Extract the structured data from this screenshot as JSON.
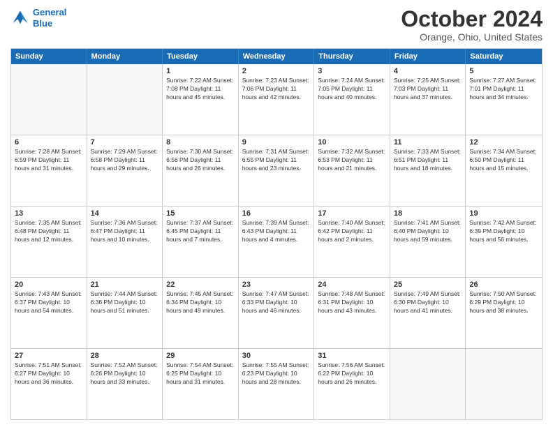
{
  "header": {
    "logo_line1": "General",
    "logo_line2": "Blue",
    "month_title": "October 2024",
    "location": "Orange, Ohio, United States"
  },
  "weekdays": [
    "Sunday",
    "Monday",
    "Tuesday",
    "Wednesday",
    "Thursday",
    "Friday",
    "Saturday"
  ],
  "rows": [
    [
      {
        "day": "",
        "info": "",
        "empty": true
      },
      {
        "day": "",
        "info": "",
        "empty": true
      },
      {
        "day": "1",
        "info": "Sunrise: 7:22 AM\nSunset: 7:08 PM\nDaylight: 11 hours and 45 minutes.",
        "empty": false
      },
      {
        "day": "2",
        "info": "Sunrise: 7:23 AM\nSunset: 7:06 PM\nDaylight: 11 hours and 42 minutes.",
        "empty": false
      },
      {
        "day": "3",
        "info": "Sunrise: 7:24 AM\nSunset: 7:05 PM\nDaylight: 11 hours and 40 minutes.",
        "empty": false
      },
      {
        "day": "4",
        "info": "Sunrise: 7:25 AM\nSunset: 7:03 PM\nDaylight: 11 hours and 37 minutes.",
        "empty": false
      },
      {
        "day": "5",
        "info": "Sunrise: 7:27 AM\nSunset: 7:01 PM\nDaylight: 11 hours and 34 minutes.",
        "empty": false
      }
    ],
    [
      {
        "day": "6",
        "info": "Sunrise: 7:28 AM\nSunset: 6:59 PM\nDaylight: 11 hours and 31 minutes.",
        "empty": false
      },
      {
        "day": "7",
        "info": "Sunrise: 7:29 AM\nSunset: 6:58 PM\nDaylight: 11 hours and 29 minutes.",
        "empty": false
      },
      {
        "day": "8",
        "info": "Sunrise: 7:30 AM\nSunset: 6:56 PM\nDaylight: 11 hours and 26 minutes.",
        "empty": false
      },
      {
        "day": "9",
        "info": "Sunrise: 7:31 AM\nSunset: 6:55 PM\nDaylight: 11 hours and 23 minutes.",
        "empty": false
      },
      {
        "day": "10",
        "info": "Sunrise: 7:32 AM\nSunset: 6:53 PM\nDaylight: 11 hours and 21 minutes.",
        "empty": false
      },
      {
        "day": "11",
        "info": "Sunrise: 7:33 AM\nSunset: 6:51 PM\nDaylight: 11 hours and 18 minutes.",
        "empty": false
      },
      {
        "day": "12",
        "info": "Sunrise: 7:34 AM\nSunset: 6:50 PM\nDaylight: 11 hours and 15 minutes.",
        "empty": false
      }
    ],
    [
      {
        "day": "13",
        "info": "Sunrise: 7:35 AM\nSunset: 6:48 PM\nDaylight: 11 hours and 12 minutes.",
        "empty": false
      },
      {
        "day": "14",
        "info": "Sunrise: 7:36 AM\nSunset: 6:47 PM\nDaylight: 11 hours and 10 minutes.",
        "empty": false
      },
      {
        "day": "15",
        "info": "Sunrise: 7:37 AM\nSunset: 6:45 PM\nDaylight: 11 hours and 7 minutes.",
        "empty": false
      },
      {
        "day": "16",
        "info": "Sunrise: 7:39 AM\nSunset: 6:43 PM\nDaylight: 11 hours and 4 minutes.",
        "empty": false
      },
      {
        "day": "17",
        "info": "Sunrise: 7:40 AM\nSunset: 6:42 PM\nDaylight: 11 hours and 2 minutes.",
        "empty": false
      },
      {
        "day": "18",
        "info": "Sunrise: 7:41 AM\nSunset: 6:40 PM\nDaylight: 10 hours and 59 minutes.",
        "empty": false
      },
      {
        "day": "19",
        "info": "Sunrise: 7:42 AM\nSunset: 6:39 PM\nDaylight: 10 hours and 56 minutes.",
        "empty": false
      }
    ],
    [
      {
        "day": "20",
        "info": "Sunrise: 7:43 AM\nSunset: 6:37 PM\nDaylight: 10 hours and 54 minutes.",
        "empty": false
      },
      {
        "day": "21",
        "info": "Sunrise: 7:44 AM\nSunset: 6:36 PM\nDaylight: 10 hours and 51 minutes.",
        "empty": false
      },
      {
        "day": "22",
        "info": "Sunrise: 7:45 AM\nSunset: 6:34 PM\nDaylight: 10 hours and 49 minutes.",
        "empty": false
      },
      {
        "day": "23",
        "info": "Sunrise: 7:47 AM\nSunset: 6:33 PM\nDaylight: 10 hours and 46 minutes.",
        "empty": false
      },
      {
        "day": "24",
        "info": "Sunrise: 7:48 AM\nSunset: 6:31 PM\nDaylight: 10 hours and 43 minutes.",
        "empty": false
      },
      {
        "day": "25",
        "info": "Sunrise: 7:49 AM\nSunset: 6:30 PM\nDaylight: 10 hours and 41 minutes.",
        "empty": false
      },
      {
        "day": "26",
        "info": "Sunrise: 7:50 AM\nSunset: 6:29 PM\nDaylight: 10 hours and 38 minutes.",
        "empty": false
      }
    ],
    [
      {
        "day": "27",
        "info": "Sunrise: 7:51 AM\nSunset: 6:27 PM\nDaylight: 10 hours and 36 minutes.",
        "empty": false
      },
      {
        "day": "28",
        "info": "Sunrise: 7:52 AM\nSunset: 6:26 PM\nDaylight: 10 hours and 33 minutes.",
        "empty": false
      },
      {
        "day": "29",
        "info": "Sunrise: 7:54 AM\nSunset: 6:25 PM\nDaylight: 10 hours and 31 minutes.",
        "empty": false
      },
      {
        "day": "30",
        "info": "Sunrise: 7:55 AM\nSunset: 6:23 PM\nDaylight: 10 hours and 28 minutes.",
        "empty": false
      },
      {
        "day": "31",
        "info": "Sunrise: 7:56 AM\nSunset: 6:22 PM\nDaylight: 10 hours and 26 minutes.",
        "empty": false
      },
      {
        "day": "",
        "info": "",
        "empty": true
      },
      {
        "day": "",
        "info": "",
        "empty": true
      }
    ]
  ]
}
